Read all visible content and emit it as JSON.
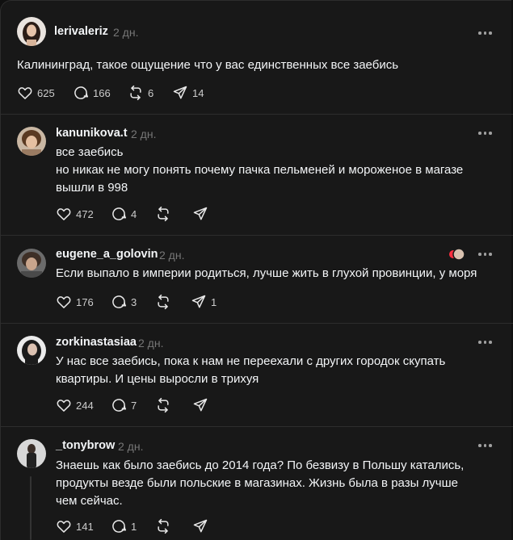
{
  "time_ago": "2 дн.",
  "posts": [
    {
      "username": "lerivaleriz",
      "lines": [
        "Калининград, такое ощущение что у вас единственных все заебись"
      ],
      "likes": "625",
      "replies": "166",
      "reposts": "6",
      "shares": "14"
    },
    {
      "username": "kanunikova.t",
      "lines": [
        "все заебись",
        "но никак не могу понять почему пачка пельменей и мороженое в магазе",
        "вышли в 998"
      ],
      "likes": "472",
      "replies": "4",
      "reposts": "",
      "shares": ""
    },
    {
      "username": "eugene_a_golovin",
      "lines": [
        "Если выпало в империи родиться, лучше жить в глухой провинции, у моря"
      ],
      "likes": "176",
      "replies": "3",
      "reposts": "",
      "shares": "1"
    },
    {
      "username": "zorkinastasiaa",
      "lines": [
        "У нас все заебись, пока к нам не переехали с других городок скупать",
        "квартиры. И цены выросли в трихуя"
      ],
      "likes": "244",
      "replies": "7",
      "reposts": "",
      "shares": ""
    },
    {
      "username": "_tonybrow",
      "lines": [
        "Знаешь как было заебись до 2014 года? По безвизу в Польшу катались,",
        "продукты везде были польские в магазинах. Жизнь была в разы лучше",
        "чем сейчас."
      ],
      "likes": "141",
      "replies": "1",
      "reposts": "",
      "shares": ""
    }
  ],
  "icons": [
    "heart-icon",
    "reply-icon",
    "repost-icon",
    "share-icon",
    "more-icon"
  ],
  "colors": {
    "background": "#181818",
    "border": "#2d2d2d",
    "text": "#f3f5f7",
    "muted": "#777777",
    "heart_red": "#ff3040"
  }
}
